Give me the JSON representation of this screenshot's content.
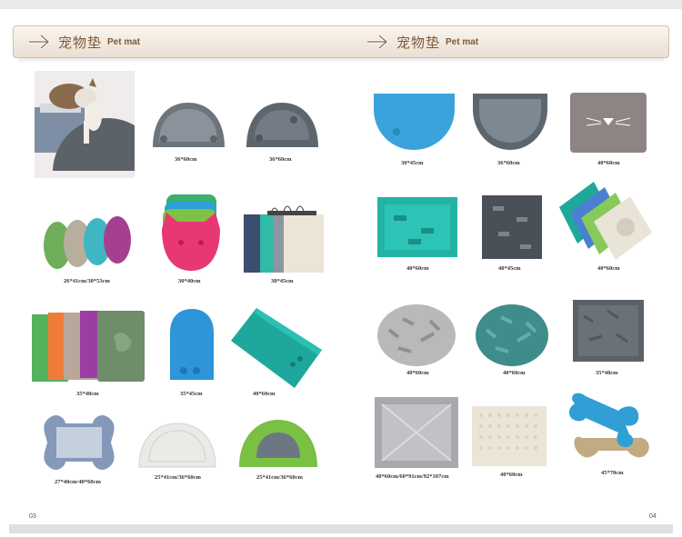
{
  "header": {
    "left": {
      "title_zh": "宠物垫",
      "title_en": "Pet mat"
    },
    "right": {
      "title_zh": "宠物垫",
      "title_en": "Pet mat"
    }
  },
  "left_page": {
    "page_number": "03",
    "captions": {
      "r1a": "36*60cm",
      "r1b": "36*60cm",
      "r2a": "26*41cm/30*53cm",
      "r2b": "30*40cm",
      "r2c": "38*45cm",
      "r3a": "35*48cm",
      "r3b": "35*45cm",
      "r3c": "40*60cm",
      "r4a": "27*40cm/40*60cm",
      "r4b": "25*41cm/36*60cm",
      "r4c": "25*41cm/36*60cm"
    }
  },
  "right_page": {
    "page_number": "04",
    "captions": {
      "r1a": "30*45cm",
      "r1b": "36*60cm",
      "r1c": "40*60cm",
      "r2a": "40*60cm",
      "r2b": "40*45cm",
      "r2c": "40*60cm",
      "r3a": "40*60cm",
      "r3b": "40*60cm",
      "r3c": "35*48cm",
      "r4a": "40*60cm/60*91cm/92*107cm",
      "r4b": "40*60cm",
      "r4c": "45*70cm"
    }
  },
  "colors": {
    "header_text": "#7d5a3d",
    "grey_mat": "#6f7880",
    "blue_mat": "#3aa3db",
    "teal_mat": "#2fb4a6",
    "green_mat": "#7dc242"
  }
}
